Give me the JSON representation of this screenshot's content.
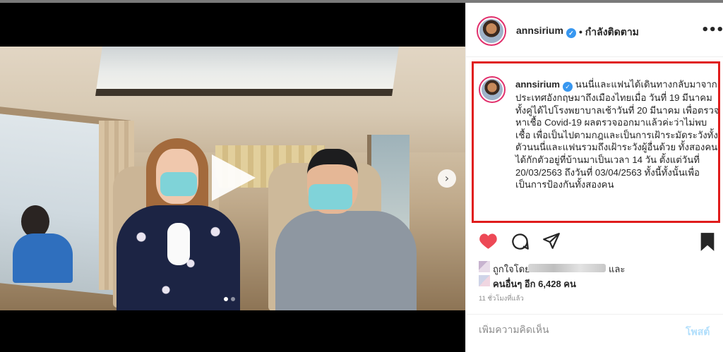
{
  "post": {
    "username": "annsirium",
    "follow_status": "• กำลังติดตาม",
    "more_icon": "more-horizontal-icon",
    "media": {
      "play_icon": "play-icon",
      "next_icon": "chevron-right-icon",
      "next_glyph": "›",
      "slide_count": 2,
      "active_slide": 0
    },
    "caption": {
      "username": "annsirium",
      "text": "นนนี่และแฟนได้เดินทางกลับมาจากประเทศอังกฤษมาถึงเมืองไทยเมื่อ วันที่ 19 มีนาคม ทั้งคู่ได้ไปโรงพยาบาลเช้าวันที่ 20 มีนาคม เพื่อตรวจหาเชื้อ Covid-19 ผลตรวจออกมาแล้วค่ะว่าไม่พบเชื้อ เพื่อเป็นไปตามกฎและเป็นการเฝ้าระมัดระวังทั้งตัวนนนี่และแฟนรวมถึงเฝ้าระวังผู้อื่นด้วย ทั้งสองคนได้กักตัวอยู่ที่บ้านมาเป็นเวลา 14 วัน ตั้งแต่วันที่ 20/03/2563 ถึงวันที่ 03/04/2563 ทั้งนี้ทั้งนั้นเพื่อเป็นการป้องกันทั้งสองคน"
    },
    "actions": {
      "like_icon": "heart-icon",
      "comment_icon": "comment-icon",
      "share_icon": "share-icon",
      "save_icon": "bookmark-icon",
      "liked": true,
      "like_color": "#ed4956"
    },
    "likes": {
      "liked_by_label": "ถูกใจโดย",
      "and_label": "และ",
      "others_label": "คนอื่นๆ อีก 6,428 คน"
    },
    "timestamp": "11 ชั่วโมงที่แล้ว",
    "comment": {
      "placeholder": "เพิ่มความคิดเห็น",
      "value": "",
      "post_label": "โพสต์"
    },
    "colors": {
      "highlight_border": "#e01c1c",
      "verified": "#3897f0",
      "post_button": "#b2dffc"
    }
  }
}
